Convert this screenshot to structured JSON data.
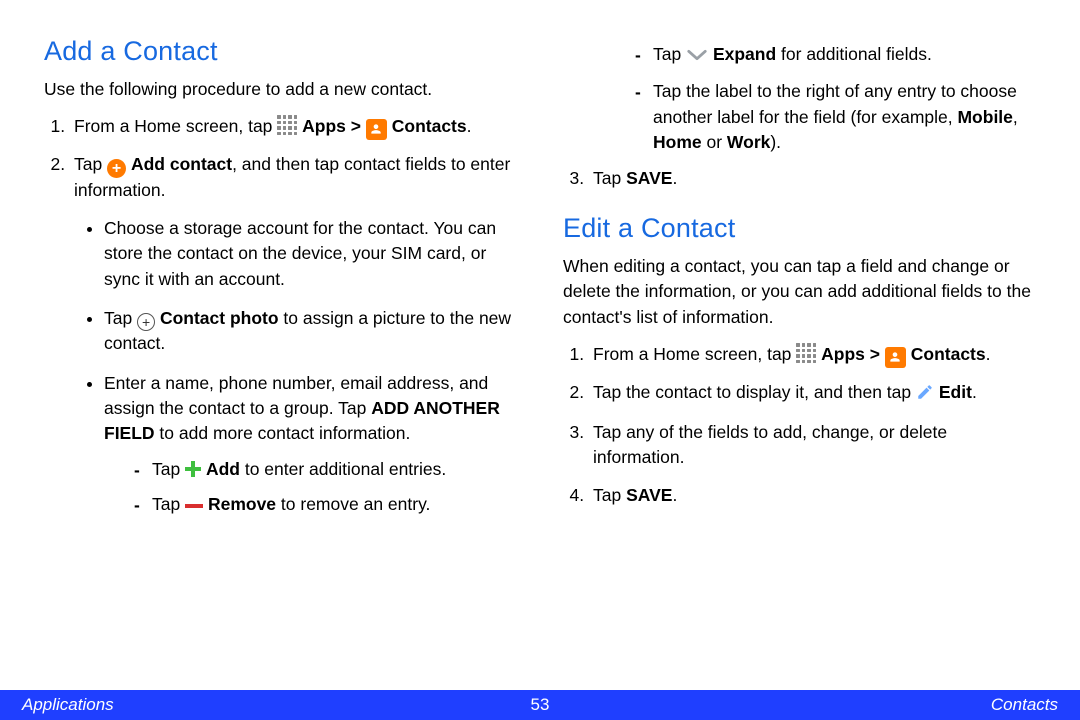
{
  "leftColumn": {
    "heading": "Add a Contact",
    "intro": "Use the following procedure to add a new contact.",
    "step1": {
      "prefix": "From a Home screen, tap ",
      "appsLabel": "Apps",
      "gt": " > ",
      "contactsLabel": "Contacts",
      "suffix": "."
    },
    "step2": {
      "prefix": "Tap ",
      "addContactLabel": "Add contact",
      "suffix": ", and then tap contact fields to enter information."
    },
    "bullets": {
      "storage": "Choose a storage account for the contact. You can store the contact on the device, your SIM card, or sync it with an account.",
      "photoPrefix": "Tap ",
      "photoLabel": "Contact photo",
      "photoSuffix": " to assign a picture to the new contact.",
      "enter": "Enter a name, phone number, email address, and assign the contact to a group. Tap ",
      "addAnother": "ADD ANOTHER FIELD",
      "enterSuffix": " to add more contact information.",
      "dashAddPrefix": "Tap ",
      "dashAddLabel": "Add",
      "dashAddSuffix": " to enter additional entries.",
      "dashRemovePrefix": "Tap ",
      "dashRemoveLabel": "Remove",
      "dashRemoveSuffix": " to remove an entry."
    }
  },
  "rightColumn": {
    "continuedDashes": {
      "expandPrefix": "Tap ",
      "expandLabel": "Expand",
      "expandSuffix": " for additional fields.",
      "labelPrefix": "Tap the label to the right of any entry to choose another label for the field (for example, ",
      "mobile": "Mobile",
      "home": "Home",
      "work": "Work",
      "labelSuffix": ")."
    },
    "step3Prefix": "Tap ",
    "saveLabel": "SAVE",
    "step3Suffix": ".",
    "editHeading": "Edit a Contact",
    "editIntro": "When editing a contact, you can tap a field and change or delete the information, or you can add additional fields to the contact's list of information.",
    "e1": {
      "prefix": "From a Home screen, tap ",
      "appsLabel": "Apps",
      "gt": " > ",
      "contactsLabel": "Contacts",
      "suffix": "."
    },
    "e2": {
      "prefix": "Tap the contact to display it, and then tap ",
      "editLabel": "Edit",
      "suffix": "."
    },
    "e3": "Tap any of the fields to add, change, or delete information.",
    "e4Prefix": "Tap ",
    "e4Suffix": "."
  },
  "footer": {
    "left": "Applications",
    "page": "53",
    "right": "Contacts"
  },
  "sep": {
    "comma": ", ",
    "or": " or "
  }
}
